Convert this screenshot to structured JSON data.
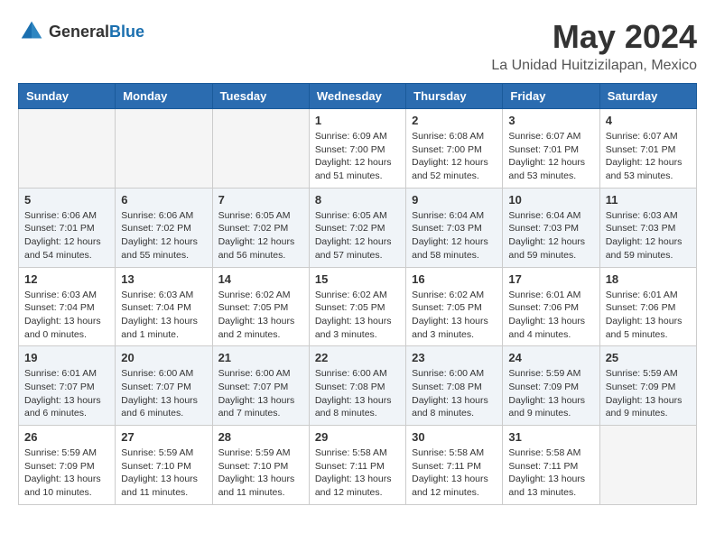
{
  "header": {
    "logo": {
      "general": "General",
      "blue": "Blue"
    },
    "month": "May 2024",
    "location": "La Unidad Huitzizilapan, Mexico"
  },
  "weekdays": [
    "Sunday",
    "Monday",
    "Tuesday",
    "Wednesday",
    "Thursday",
    "Friday",
    "Saturday"
  ],
  "weeks": [
    {
      "rowClass": "row-odd",
      "days": [
        {
          "number": "",
          "info": "",
          "empty": true
        },
        {
          "number": "",
          "info": "",
          "empty": true
        },
        {
          "number": "",
          "info": "",
          "empty": true
        },
        {
          "number": "1",
          "info": "Sunrise: 6:09 AM\nSunset: 7:00 PM\nDaylight: 12 hours\nand 51 minutes.",
          "empty": false
        },
        {
          "number": "2",
          "info": "Sunrise: 6:08 AM\nSunset: 7:00 PM\nDaylight: 12 hours\nand 52 minutes.",
          "empty": false
        },
        {
          "number": "3",
          "info": "Sunrise: 6:07 AM\nSunset: 7:01 PM\nDaylight: 12 hours\nand 53 minutes.",
          "empty": false
        },
        {
          "number": "4",
          "info": "Sunrise: 6:07 AM\nSunset: 7:01 PM\nDaylight: 12 hours\nand 53 minutes.",
          "empty": false
        }
      ]
    },
    {
      "rowClass": "row-even",
      "days": [
        {
          "number": "5",
          "info": "Sunrise: 6:06 AM\nSunset: 7:01 PM\nDaylight: 12 hours\nand 54 minutes.",
          "empty": false
        },
        {
          "number": "6",
          "info": "Sunrise: 6:06 AM\nSunset: 7:02 PM\nDaylight: 12 hours\nand 55 minutes.",
          "empty": false
        },
        {
          "number": "7",
          "info": "Sunrise: 6:05 AM\nSunset: 7:02 PM\nDaylight: 12 hours\nand 56 minutes.",
          "empty": false
        },
        {
          "number": "8",
          "info": "Sunrise: 6:05 AM\nSunset: 7:02 PM\nDaylight: 12 hours\nand 57 minutes.",
          "empty": false
        },
        {
          "number": "9",
          "info": "Sunrise: 6:04 AM\nSunset: 7:03 PM\nDaylight: 12 hours\nand 58 minutes.",
          "empty": false
        },
        {
          "number": "10",
          "info": "Sunrise: 6:04 AM\nSunset: 7:03 PM\nDaylight: 12 hours\nand 59 minutes.",
          "empty": false
        },
        {
          "number": "11",
          "info": "Sunrise: 6:03 AM\nSunset: 7:03 PM\nDaylight: 12 hours\nand 59 minutes.",
          "empty": false
        }
      ]
    },
    {
      "rowClass": "row-odd",
      "days": [
        {
          "number": "12",
          "info": "Sunrise: 6:03 AM\nSunset: 7:04 PM\nDaylight: 13 hours\nand 0 minutes.",
          "empty": false
        },
        {
          "number": "13",
          "info": "Sunrise: 6:03 AM\nSunset: 7:04 PM\nDaylight: 13 hours\nand 1 minute.",
          "empty": false
        },
        {
          "number": "14",
          "info": "Sunrise: 6:02 AM\nSunset: 7:05 PM\nDaylight: 13 hours\nand 2 minutes.",
          "empty": false
        },
        {
          "number": "15",
          "info": "Sunrise: 6:02 AM\nSunset: 7:05 PM\nDaylight: 13 hours\nand 3 minutes.",
          "empty": false
        },
        {
          "number": "16",
          "info": "Sunrise: 6:02 AM\nSunset: 7:05 PM\nDaylight: 13 hours\nand 3 minutes.",
          "empty": false
        },
        {
          "number": "17",
          "info": "Sunrise: 6:01 AM\nSunset: 7:06 PM\nDaylight: 13 hours\nand 4 minutes.",
          "empty": false
        },
        {
          "number": "18",
          "info": "Sunrise: 6:01 AM\nSunset: 7:06 PM\nDaylight: 13 hours\nand 5 minutes.",
          "empty": false
        }
      ]
    },
    {
      "rowClass": "row-even",
      "days": [
        {
          "number": "19",
          "info": "Sunrise: 6:01 AM\nSunset: 7:07 PM\nDaylight: 13 hours\nand 6 minutes.",
          "empty": false
        },
        {
          "number": "20",
          "info": "Sunrise: 6:00 AM\nSunset: 7:07 PM\nDaylight: 13 hours\nand 6 minutes.",
          "empty": false
        },
        {
          "number": "21",
          "info": "Sunrise: 6:00 AM\nSunset: 7:07 PM\nDaylight: 13 hours\nand 7 minutes.",
          "empty": false
        },
        {
          "number": "22",
          "info": "Sunrise: 6:00 AM\nSunset: 7:08 PM\nDaylight: 13 hours\nand 8 minutes.",
          "empty": false
        },
        {
          "number": "23",
          "info": "Sunrise: 6:00 AM\nSunset: 7:08 PM\nDaylight: 13 hours\nand 8 minutes.",
          "empty": false
        },
        {
          "number": "24",
          "info": "Sunrise: 5:59 AM\nSunset: 7:09 PM\nDaylight: 13 hours\nand 9 minutes.",
          "empty": false
        },
        {
          "number": "25",
          "info": "Sunrise: 5:59 AM\nSunset: 7:09 PM\nDaylight: 13 hours\nand 9 minutes.",
          "empty": false
        }
      ]
    },
    {
      "rowClass": "row-odd",
      "days": [
        {
          "number": "26",
          "info": "Sunrise: 5:59 AM\nSunset: 7:09 PM\nDaylight: 13 hours\nand 10 minutes.",
          "empty": false
        },
        {
          "number": "27",
          "info": "Sunrise: 5:59 AM\nSunset: 7:10 PM\nDaylight: 13 hours\nand 11 minutes.",
          "empty": false
        },
        {
          "number": "28",
          "info": "Sunrise: 5:59 AM\nSunset: 7:10 PM\nDaylight: 13 hours\nand 11 minutes.",
          "empty": false
        },
        {
          "number": "29",
          "info": "Sunrise: 5:58 AM\nSunset: 7:11 PM\nDaylight: 13 hours\nand 12 minutes.",
          "empty": false
        },
        {
          "number": "30",
          "info": "Sunrise: 5:58 AM\nSunset: 7:11 PM\nDaylight: 13 hours\nand 12 minutes.",
          "empty": false
        },
        {
          "number": "31",
          "info": "Sunrise: 5:58 AM\nSunset: 7:11 PM\nDaylight: 13 hours\nand 13 minutes.",
          "empty": false
        },
        {
          "number": "",
          "info": "",
          "empty": true
        }
      ]
    }
  ]
}
